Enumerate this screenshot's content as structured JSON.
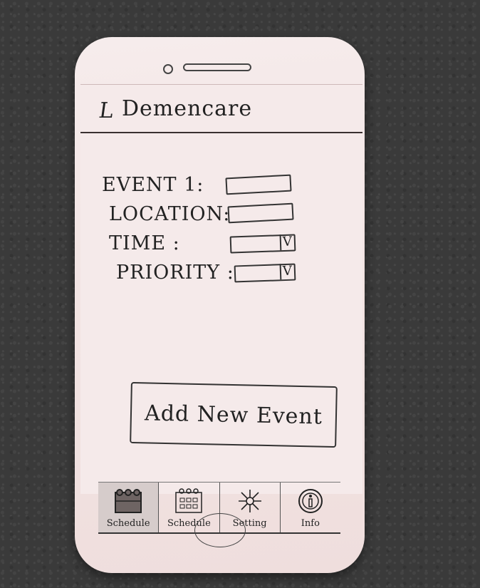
{
  "header": {
    "back_glyph": "L",
    "title": "Demencare"
  },
  "form": {
    "fields": [
      {
        "label": "EVENT 1:",
        "type": "text",
        "value": ""
      },
      {
        "label": "LOCATION:",
        "type": "text",
        "value": ""
      },
      {
        "label": "TIME   :",
        "type": "select",
        "value": "",
        "arrow": "V"
      },
      {
        "label": "PRIORITY :",
        "type": "select",
        "value": "",
        "arrow": "V"
      }
    ],
    "submit_label": "Add New Event"
  },
  "tabbar": {
    "tabs": [
      {
        "label": "Schedule",
        "icon": "schedule-icon",
        "active": true
      },
      {
        "label": "Schedule",
        "icon": "calendar-icon",
        "active": false
      },
      {
        "label": "Setting",
        "icon": "gear-icon",
        "active": false
      },
      {
        "label": "Info",
        "icon": "info-icon",
        "active": false
      }
    ]
  },
  "colors": {
    "paper": "#f5eaea",
    "ink": "#222222",
    "background": "#3a3a3a"
  }
}
